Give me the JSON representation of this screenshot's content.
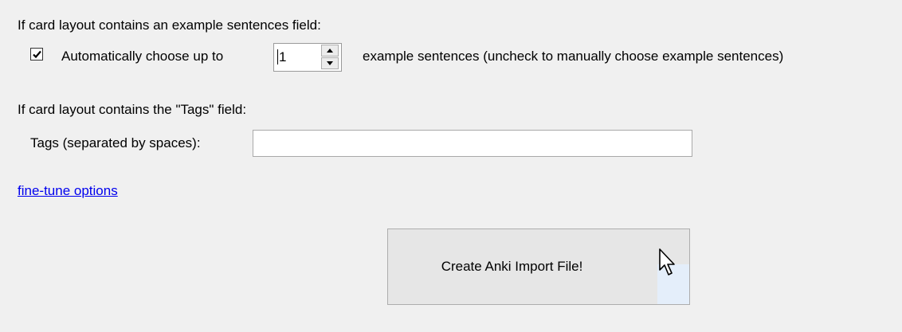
{
  "example_sentences": {
    "section_label": "If card layout contains an example sentences field:",
    "auto_choose_checked": true,
    "auto_choose_label": "Automatically choose up to",
    "count_value": "1",
    "suffix_label": "example sentences (uncheck to manually choose example sentences)"
  },
  "tags": {
    "section_label": "If card layout contains the \"Tags\" field:",
    "field_label": "Tags (separated by spaces):",
    "value": ""
  },
  "fine_tune_link": "fine-tune options",
  "create_button_label": "Create Anki Import File!",
  "icons": {
    "checkmark": "check-mark-icon",
    "spin_up": "spin-up-arrow-icon",
    "spin_down": "spin-down-arrow-icon",
    "cursor": "mouse-pointer-icon"
  },
  "colors": {
    "background": "#f0f0f0",
    "link": "#0000ee",
    "button_face": "#e6e6e6",
    "button_hover": "#e4eefa"
  }
}
